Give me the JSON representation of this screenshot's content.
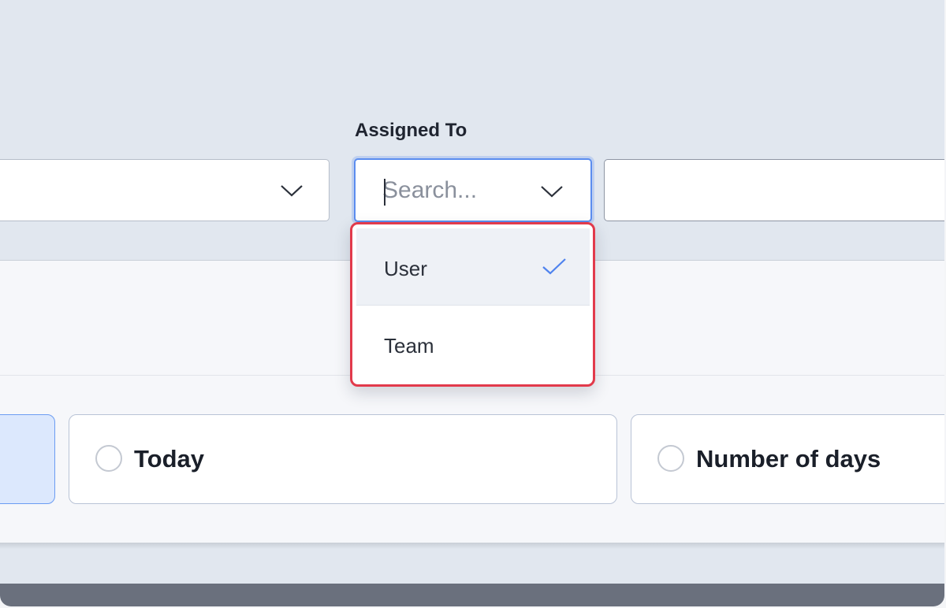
{
  "filters": {
    "assigned_to": {
      "label": "Assigned To",
      "placeholder": "Search...",
      "value": "",
      "options": [
        {
          "label": "User",
          "selected": true
        },
        {
          "label": "Team",
          "selected": false
        }
      ]
    }
  },
  "date_options": {
    "today_label": "Today",
    "days_label": "Number of days"
  },
  "icons": {
    "dropdown": "chevron-down-icon",
    "selected": "check-icon"
  },
  "colors": {
    "focus": "#5b8def",
    "highlight_border": "#e23a4b",
    "selected_card": "#dce8fd"
  }
}
